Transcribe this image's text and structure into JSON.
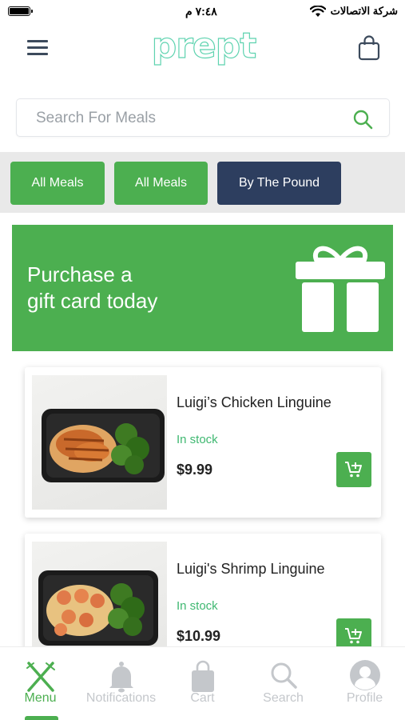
{
  "status_bar": {
    "time": "٧:٤٨ م",
    "carrier": "شركة الاتصالات"
  },
  "header": {
    "logo_text": "prept",
    "menu_icon": "hamburger-menu-icon",
    "bag_icon": "shopping-bag-icon"
  },
  "search": {
    "placeholder": "Search For Meals",
    "value": "",
    "icon": "search-icon"
  },
  "categories": [
    {
      "label": "All Meals",
      "style": "green"
    },
    {
      "label": "All Meals",
      "style": "green"
    },
    {
      "label": "By The Pound",
      "style": "navy"
    }
  ],
  "gift_banner": {
    "text": "Purchase a\ngift card today",
    "icon": "gift-icon"
  },
  "products": [
    {
      "name": "Luigi’s Chicken Linguine",
      "stock": "In stock",
      "price": "$9.99"
    },
    {
      "name": "Luigi's Shrimp Linguine",
      "stock": "In stock",
      "price": "$10.99"
    }
  ],
  "tabs": [
    {
      "label": "Menu",
      "icon": "fork-knife-icon",
      "active": true
    },
    {
      "label": "Notifications",
      "icon": "bell-icon",
      "active": false
    },
    {
      "label": "Cart",
      "icon": "shopping-bag-icon",
      "active": false
    },
    {
      "label": "Search",
      "icon": "search-icon",
      "active": false
    },
    {
      "label": "Profile",
      "icon": "user-avatar-icon",
      "active": false
    }
  ],
  "colors": {
    "accent_green": "#4caf50",
    "navy": "#2d3e5f",
    "stock_green": "#3fb871",
    "inactive_tab": "#c4c7cb"
  }
}
